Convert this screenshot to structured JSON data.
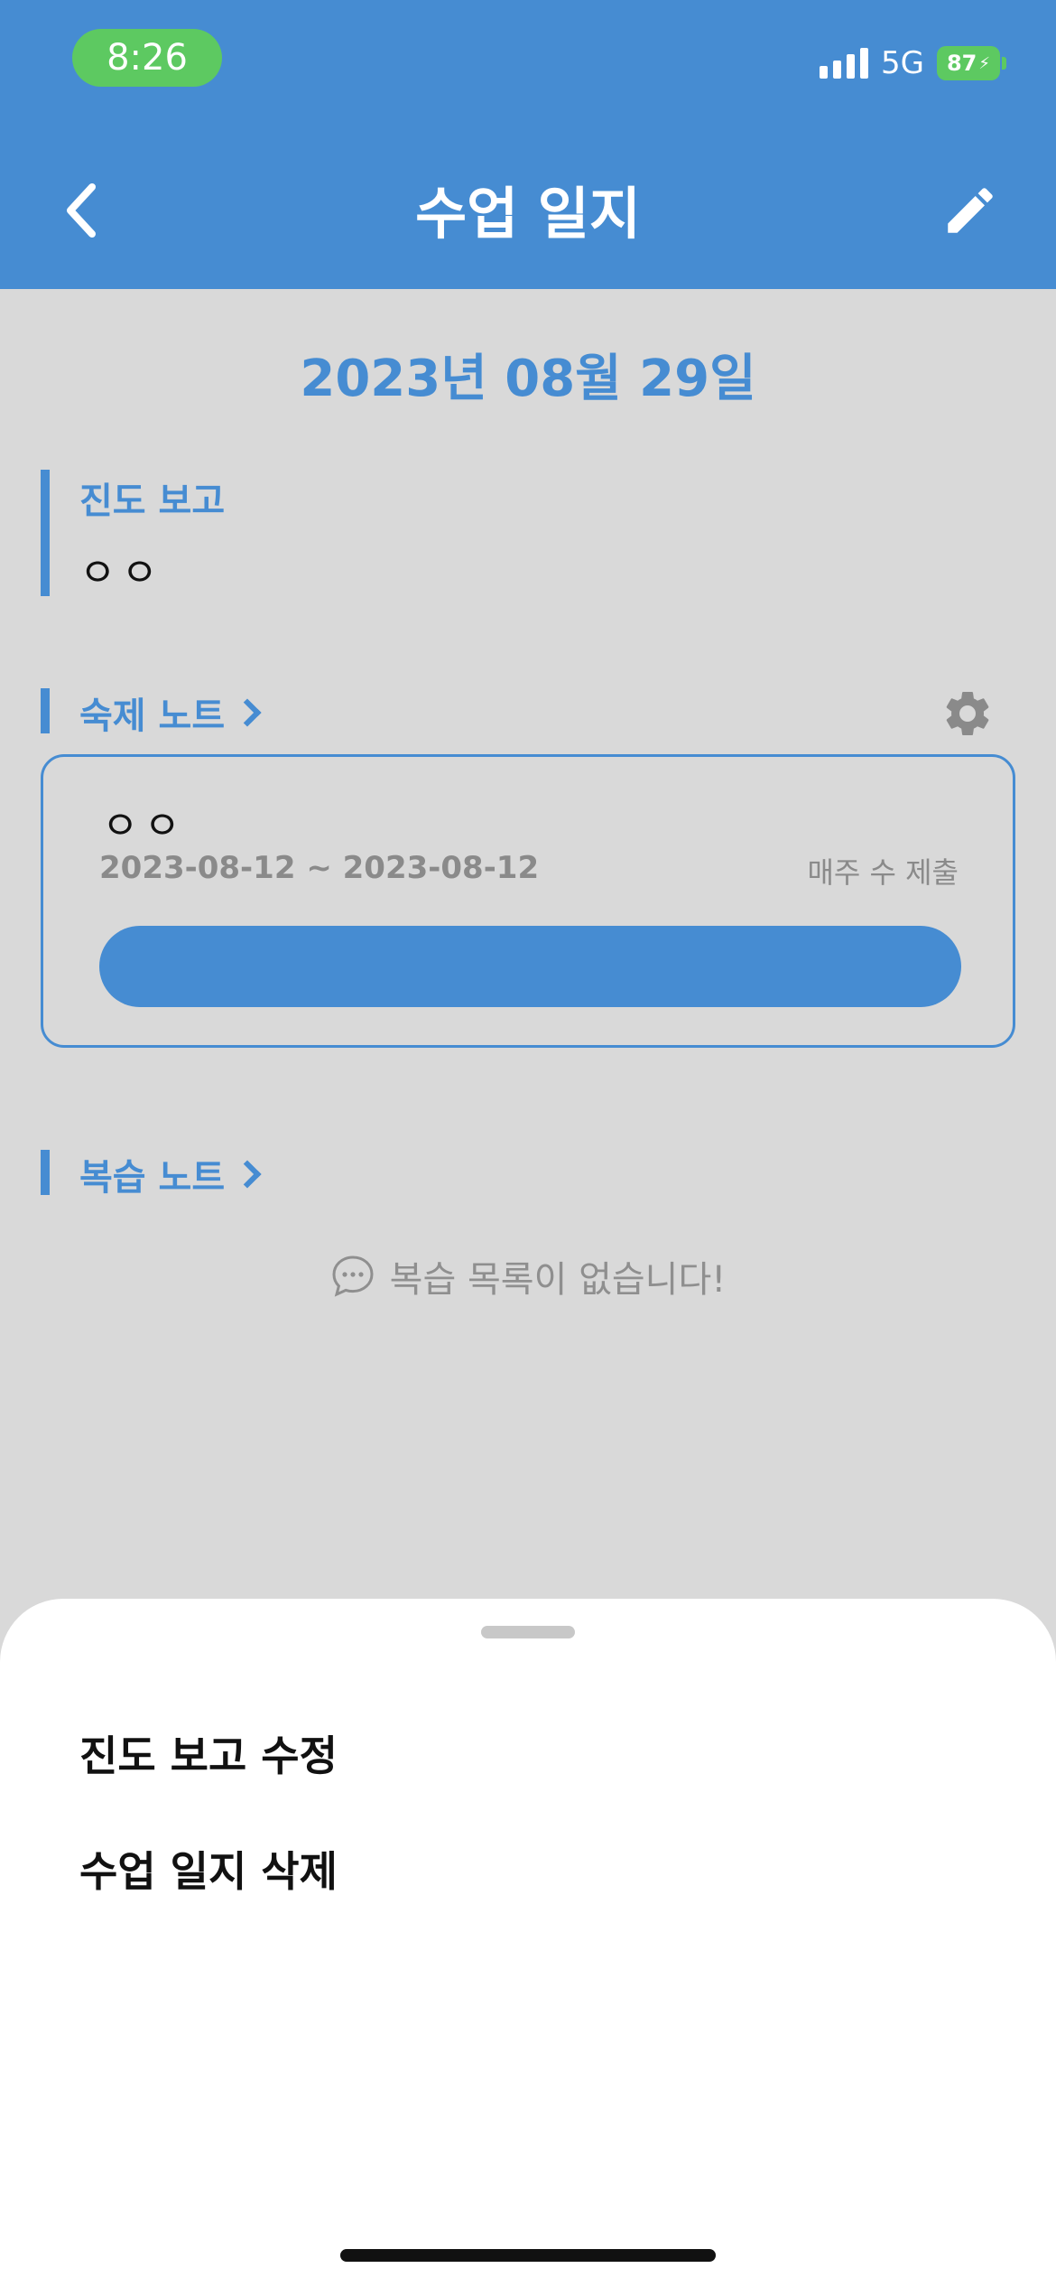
{
  "status_bar": {
    "time": "8:26",
    "network": "5G",
    "battery": "87"
  },
  "nav": {
    "title": "수업 일지",
    "back_icon": "chevron-left-icon",
    "edit_icon": "pencil-icon"
  },
  "date": "2023년 08월 29일",
  "progress_report": {
    "title": "진도 보고",
    "value": "ㅇㅇ"
  },
  "homework": {
    "title": "숙제 노트",
    "settings_icon": "gear-icon",
    "card": {
      "name": "ㅇㅇ",
      "dates": "2023-08-12 ~ 2023-08-12",
      "frequency": "매주 수 제출"
    }
  },
  "review": {
    "title": "복습 노트",
    "empty_message": "복습 목록이 없습니다!"
  },
  "sheet": {
    "items": [
      {
        "label": "진도 보고 수정"
      },
      {
        "label": "수업 일지 삭제"
      }
    ]
  },
  "colors": {
    "primary": "#468cd2",
    "background": "#d9d9d9",
    "status_green": "#5dc961"
  }
}
